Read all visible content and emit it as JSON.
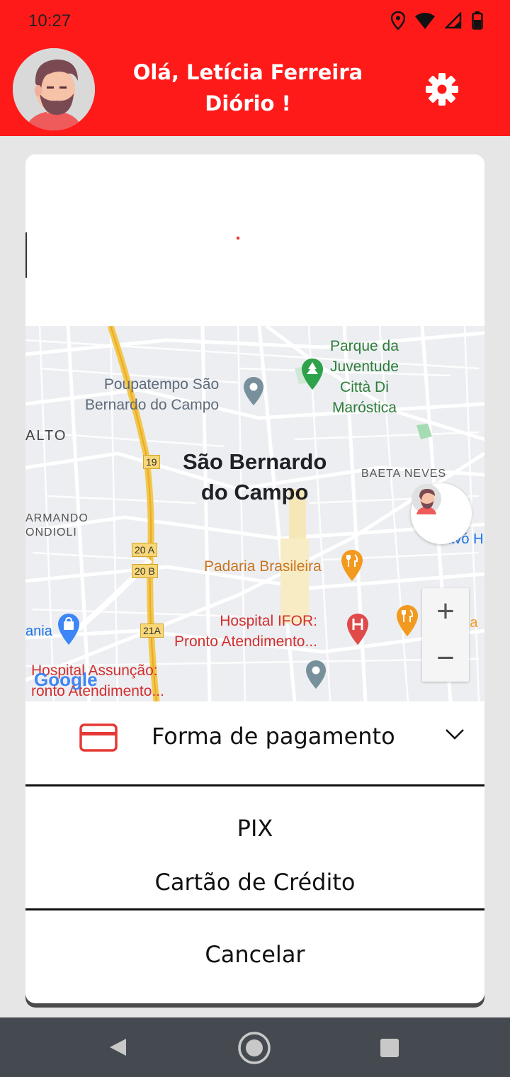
{
  "status_bar": {
    "time": "10:27"
  },
  "header": {
    "greeting_line1": "Olá, Letícia Ferreira",
    "greeting_line2": "Diório !"
  },
  "map": {
    "labels": {
      "poupatempo_1": "Poupatempo São",
      "poupatempo_2": "Bernardo do Campo",
      "parque_1": "Parque da",
      "parque_2": "Juventude",
      "parque_3": "Città Di",
      "parque_4": "Maróstica",
      "city_1": "São Bernardo",
      "city_2": "do Campo",
      "baeta": "BAETA NEVES",
      "alto": "ALTO",
      "armando_1": "ARMANDO",
      "armando_2": "ONDIOLI",
      "padaria": "Padaria Brasileira",
      "hospital_ifor_1": "Hospital IFOR:",
      "hospital_ifor_2": "Pronto Atendimento...",
      "hospital_assuncao_1": "Hospital Assunção:",
      "hospital_assuncao_2": "ronto Atendimento...",
      "mcdonalds": "McDona",
      "davo": "D'avó H",
      "ania": "ania",
      "road_19": "19",
      "road_20a": "20 A",
      "road_20b": "20 B",
      "road_21a": "21A",
      "google": "Google",
      "zoom_in": "+",
      "zoom_out": "−"
    }
  },
  "payment": {
    "label": "Forma de pagamento",
    "options": [
      "PIX",
      "Cartão de Crédito"
    ],
    "cancel": "Cancelar"
  },
  "colors": {
    "brand_red": "#ff1a1a"
  }
}
